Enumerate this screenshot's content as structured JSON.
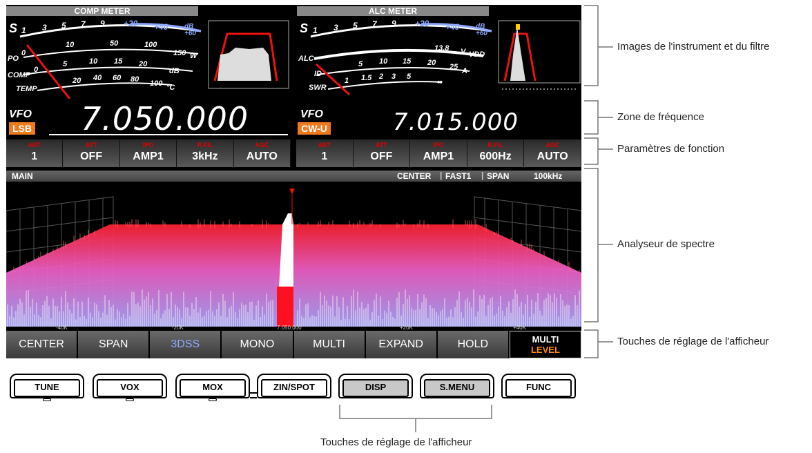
{
  "comp_meter": {
    "title": "COMP METER",
    "s_label": "S",
    "s_ticks": [
      "1",
      "3",
      "5",
      "7",
      "9",
      "+20",
      "+40",
      "dB +60"
    ],
    "po_label": "PO",
    "po_ticks": [
      "0",
      "10",
      "50",
      "100",
      "150"
    ],
    "po_unit": "W",
    "comp_label": "COMP",
    "comp_ticks": [
      "0",
      "5",
      "10",
      "15",
      "20"
    ],
    "comp_unit": "dB",
    "temp_label": "TEMP",
    "temp_ticks": [
      "20",
      "40",
      "60",
      "80",
      "100"
    ],
    "temp_unit": "°C"
  },
  "alc_meter": {
    "title": "ALC METER",
    "s_label": "S",
    "s_ticks": [
      "1",
      "3",
      "5",
      "7",
      "9",
      "+20",
      "+40",
      "dB +60"
    ],
    "alc_label": "ALC",
    "vdd_value": "13.8",
    "vdd_unit": "V",
    "vdd_label": "VDD",
    "id_label": "ID",
    "id_ticks": [
      "5",
      "10",
      "15",
      "20",
      "25"
    ],
    "id_unit": "A",
    "swr_label": "SWR",
    "swr_ticks": [
      "1",
      "1.5",
      "2",
      "3",
      "5",
      "∞"
    ]
  },
  "vfo_main": {
    "label": "VFO",
    "mode": "LSB",
    "frequency": "7.050.000"
  },
  "vfo_sub": {
    "label": "VFO",
    "mode": "CW-U",
    "frequency": "7.015.000"
  },
  "params_left": [
    {
      "key": "ANT",
      "value": "1"
    },
    {
      "key": "ATT",
      "value": "OFF"
    },
    {
      "key": "IPO",
      "value": "AMP1"
    },
    {
      "key": "R.FIL",
      "value": "3kHz"
    },
    {
      "key": "AGC",
      "value": "AUTO"
    }
  ],
  "params_right": [
    {
      "key": "ANT",
      "value": "1"
    },
    {
      "key": "ATT",
      "value": "OFF"
    },
    {
      "key": "IPO",
      "value": "AMP1"
    },
    {
      "key": "R.FIL",
      "value": "600Hz"
    },
    {
      "key": "AGC",
      "value": "AUTO"
    }
  ],
  "scope": {
    "name": "MAIN",
    "mode": "CENTER",
    "speed": "FAST1",
    "span_label": "SPAN",
    "span_value": "100kHz",
    "ticks": [
      "-40K",
      "-20K",
      "7.050.000",
      "+20K",
      "+40K"
    ]
  },
  "softkeys": [
    "CENTER",
    "SPAN",
    "3DSS",
    "MONO",
    "MULTI",
    "EXPAND",
    "HOLD"
  ],
  "softkey_multi": {
    "line1": "MULTI",
    "line2": "LEVEL"
  },
  "hardware_buttons": [
    "TUNE",
    "VOX",
    "MOX",
    "ZIN/SPOT",
    "DISP",
    "S.MENU",
    "FUNC"
  ],
  "annotations": {
    "instrument": "Images de l'instrument et du filtre",
    "frequency": "Zone de fréquence",
    "function": "Paramètres de fonction",
    "spectrum": "Analyseur de spectre",
    "display_keys": "Touches de réglage de l'afficheur",
    "bottom": "Touches de réglage de l'afficheur"
  },
  "colors": {
    "mode_badge": "#ee7a1e",
    "param_key": "#e10000",
    "level": "#ff8c00",
    "spectrum_hot": "#ff2030",
    "spectrum_cold": "#a8a8ff"
  }
}
